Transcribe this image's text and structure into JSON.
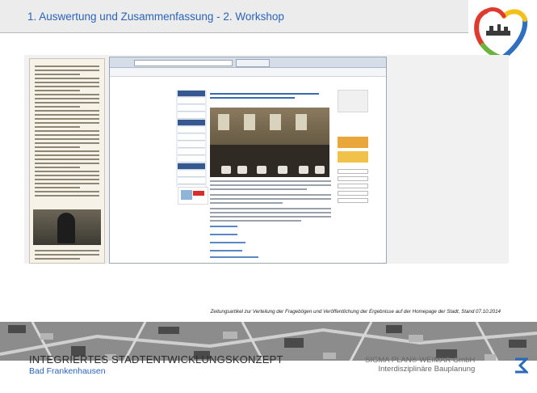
{
  "slide": {
    "title": "1. Auswertung und Zusammenfassung - 2. Workshop",
    "caption": "Zeitungsartikel zur Verteilung der Fragebögen und Veröffentlichung der Ergebnisse auf der Homepage der Stadt, Stand 07.10.2014"
  },
  "footer": {
    "title": "INTEGRIERTES STADTENTWICKLUNGSKONZEPT",
    "subtitle": "Bad Frankenhausen",
    "company_name": "SIGMA PLAN® WEIMAR GmbH",
    "company_tagline": "Interdisziplinäre  Bauplanung"
  },
  "icons": {
    "logo": "heart-logo-icon",
    "company_logo": "sigmaplan-logo-icon"
  },
  "colors": {
    "title_blue": "#2b63b5",
    "band_grey": "#ececec",
    "logo_red": "#e03a2e",
    "logo_yellow": "#f3c21a",
    "logo_green": "#6cb33e",
    "logo_blue": "#2e6fc0",
    "company_blue": "#2a6bb8"
  }
}
